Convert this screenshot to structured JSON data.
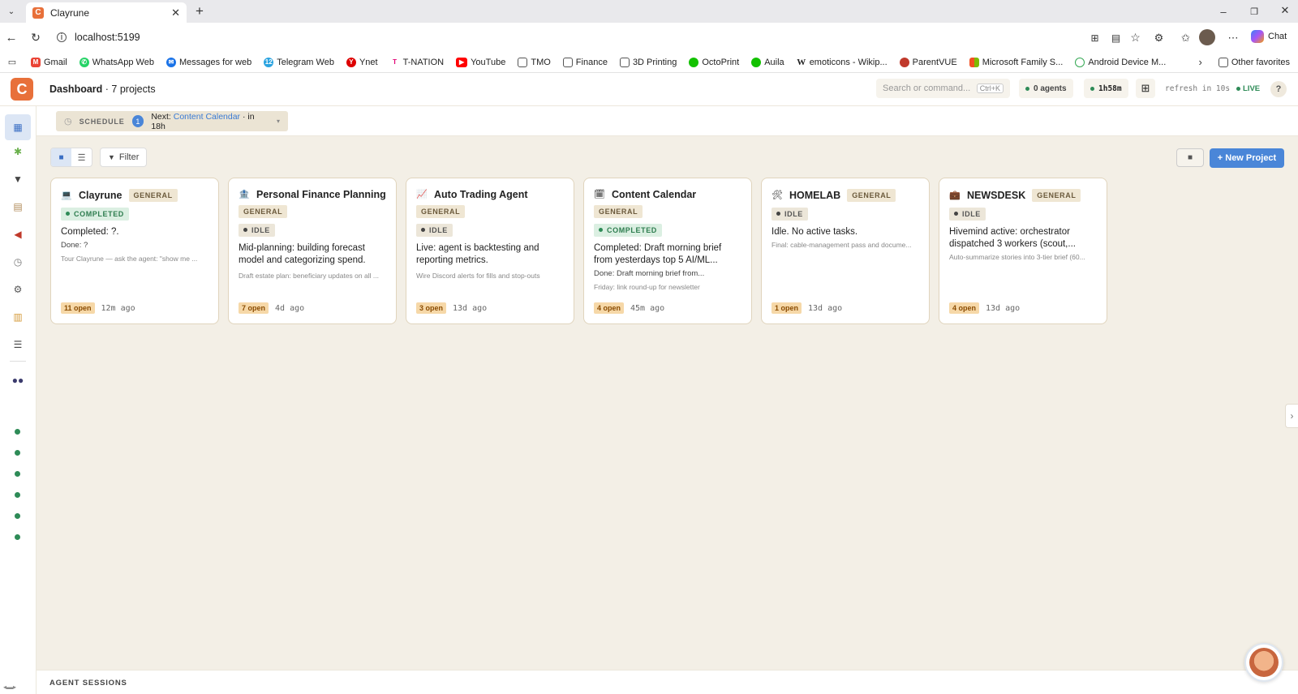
{
  "browser": {
    "tab_title": "Clayrune",
    "url": "localhost:5199",
    "chat_label": "Chat",
    "bookmarks": [
      "Gmail",
      "WhatsApp Web",
      "Messages for web",
      "Telegram Web",
      "Ynet",
      "T-NATION",
      "YouTube",
      "TMO",
      "Finance",
      "3D Printing",
      "OctoPrint",
      "Auila",
      "emoticons - Wikip...",
      "ParentVUE",
      "Microsoft Family S...",
      "Android Device M..."
    ],
    "other_favorites": "Other favorites"
  },
  "app": {
    "logo_letter": "C",
    "title": "Dashboard",
    "subtitle": "· 7 projects",
    "search_placeholder": "Search or command...",
    "search_shortcut": "Ctrl+K",
    "agents": "0 agents",
    "uptime": "1h58m",
    "refresh": "refresh in 10s",
    "live": "LIVE",
    "help": "?"
  },
  "schedule": {
    "label": "SCHEDULE",
    "count": "1",
    "next_prefix": "Next:",
    "next_link": "Content Calendar",
    "next_suffix": "· in 18h"
  },
  "toolbar": {
    "filter_label": "Filter",
    "new_project_label": "+ New Project"
  },
  "projects": [
    {
      "name": "Clayrune",
      "icon": "💻",
      "tag": "GENERAL",
      "status": "COMPLETED",
      "desc": "Completed: ?.",
      "done": "Done: ?",
      "note": "Tour Clayrune — ask the agent: \"show me ...",
      "open": "11 open",
      "ago": "12m ago"
    },
    {
      "name": "Personal Finance Planning",
      "icon": "🏦",
      "tag": "GENERAL",
      "status": "IDLE",
      "desc": "Mid-planning: building forecast model and categorizing spend.",
      "done": "",
      "note": "Draft estate plan: beneficiary updates on all ...",
      "open": "7 open",
      "ago": "4d ago"
    },
    {
      "name": "Auto Trading Agent",
      "icon": "📈",
      "tag": "GENERAL",
      "status": "IDLE",
      "desc": "Live: agent is backtesting and reporting metrics.",
      "done": "",
      "note": "Wire Discord alerts for fills and stop-outs",
      "open": "3 open",
      "ago": "13d ago"
    },
    {
      "name": "Content Calendar",
      "icon": "🗓",
      "tag": "GENERAL",
      "status": "COMPLETED",
      "desc": "Completed: Draft morning brief from yesterdays top 5 AI/ML...",
      "done": "Done: Draft morning brief from...",
      "note": "Friday: link round-up for newsletter",
      "open": "4 open",
      "ago": "45m ago"
    },
    {
      "name": "HOMELAB",
      "icon": "🛠",
      "tag": "GENERAL",
      "status": "IDLE",
      "desc": "Idle. No active tasks.",
      "done": "",
      "note": "Final: cable-management pass and docume...",
      "open": "1 open",
      "ago": "13d ago"
    },
    {
      "name": "NEWSDESK",
      "icon": "💼",
      "tag": "GENERAL",
      "status": "IDLE",
      "desc": "Hivemind active: orchestrator dispatched 3 workers (scout,...",
      "done": "",
      "note": "Auto-summarize stories into 3-tier brief (60...",
      "open": "4 open",
      "ago": "13d ago"
    }
  ],
  "footer": {
    "label": "AGENT SESSIONS"
  },
  "colors": {
    "accent": "#e8703a",
    "primary": "#4a86d8",
    "status_green": "#2e8b57",
    "canvas": "#f3efe6"
  }
}
